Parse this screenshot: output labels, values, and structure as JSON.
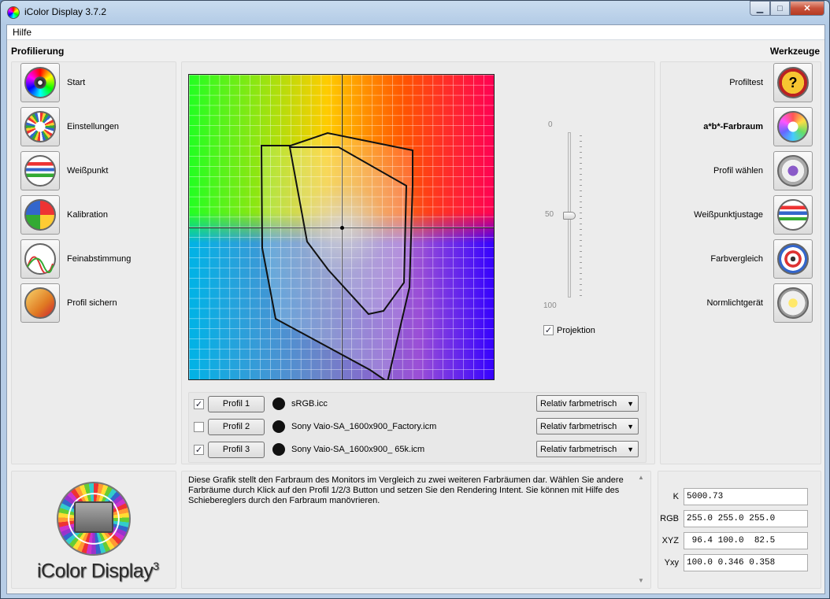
{
  "window": {
    "title": "iColor Display 3.7.2"
  },
  "menu": {
    "help": "Hilfe"
  },
  "left_panel": {
    "title": "Profilierung",
    "items": [
      {
        "label": "Start",
        "icon": "start-icon"
      },
      {
        "label": "Einstellungen",
        "icon": "settings-icon"
      },
      {
        "label": "Weißpunkt",
        "icon": "whitepoint-icon"
      },
      {
        "label": "Kalibration",
        "icon": "calibration-icon"
      },
      {
        "label": "Feinabstimmung",
        "icon": "finetune-icon"
      },
      {
        "label": "Profil sichern",
        "icon": "save-profile-icon"
      }
    ]
  },
  "right_panel": {
    "title": "Werkzeuge",
    "items": [
      {
        "label": "Profiltest",
        "icon": "profiletest-icon"
      },
      {
        "label": "a*b*-Farbraum",
        "icon": "gamut-icon",
        "active": true
      },
      {
        "label": "Profil wählen",
        "icon": "choose-profile-icon"
      },
      {
        "label": "Weißpunktjustage",
        "icon": "whitepoint-adjust-icon"
      },
      {
        "label": "Farbvergleich",
        "icon": "color-compare-icon"
      },
      {
        "label": "Normlichtgerät",
        "icon": "normlight-icon"
      }
    ]
  },
  "slider": {
    "top_label": "0",
    "mid_label": "50",
    "bottom_label": "100",
    "value": 50
  },
  "projection": {
    "label": "Projektion",
    "checked": true
  },
  "profiles": [
    {
      "checked": true,
      "button": "Profil 1",
      "file": "sRGB.icc",
      "intent": "Relativ farbmetrisch"
    },
    {
      "checked": false,
      "button": "Profil 2",
      "file": "Sony Vaio-SA_1600x900_Factory.icm",
      "intent": "Relativ farbmetrisch"
    },
    {
      "checked": true,
      "button": "Profil 3",
      "file": "Sony Vaio-SA_1600x900_ 65k.icm",
      "intent": "Relativ farbmetrisch"
    }
  ],
  "description": {
    "line1": "Diese Grafik stellt den Farbraum des Monitors im Vergleich zu zwei weiteren Farbräumen dar. Wählen Sie andere",
    "line2": "Farbräume durch Klick auf den Profil 1/2/3 Button und setzen Sie den Rendering Intent. Sie können mit Hilfe des",
    "line3": "Schiebereglers durch den Farbraum manövrieren."
  },
  "logo": {
    "text": "iColor Display",
    "superscript": "3"
  },
  "readouts": [
    {
      "label": "K",
      "value": "5000.73"
    },
    {
      "label": "RGB",
      "value": "255.0 255.0 255.0"
    },
    {
      "label": "XYZ",
      "value": " 96.4 100.0  82.5"
    },
    {
      "label": "Yxy",
      "value": "100.0 0.346 0.358"
    }
  ]
}
